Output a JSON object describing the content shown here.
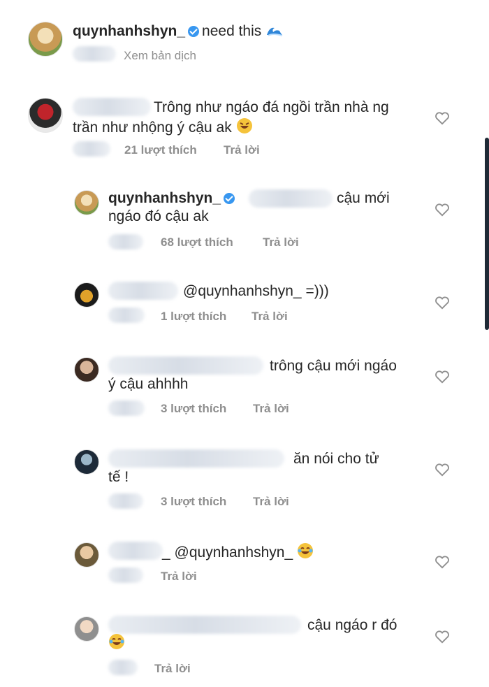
{
  "post": {
    "username": "quynhanhshyn_",
    "caption": "need this",
    "caption_emoji": "wave-icon",
    "translate_label": "Xem bản dịch"
  },
  "comments": [
    {
      "text_line1": "Trông như ngáo đá ngồi trần nhà ng",
      "text_line2": "trần như nhộng ý cậu ak",
      "emoji": "rofl-emoji",
      "likes": "21 lượt thích",
      "reply_label": "Trả lời"
    },
    {
      "username": "quynhanhshyn_",
      "text_line1": "cậu mới",
      "text_line2": "ngáo đó cậu ak",
      "likes": "68 lượt thích",
      "reply_label": "Trả lời"
    },
    {
      "text_line1": "@quynhanhshyn_ =)))",
      "likes": "1 lượt thích",
      "reply_label": "Trả lời"
    },
    {
      "text_line1": "trông cậu mới ngáo",
      "text_line2": "ý cậu ahhhh",
      "likes": "3 lượt thích",
      "reply_label": "Trả lời"
    },
    {
      "text_line1": "ăn nói cho tử",
      "text_line2": "tế !",
      "likes": "3 lượt thích",
      "reply_label": "Trả lời"
    },
    {
      "text_line1": "_ @quynhanhshyn_",
      "emoji": "tears-of-joy-emoji",
      "reply_label": "Trả lời"
    },
    {
      "text_line1": "cậu ngáo r đó",
      "emoji": "tears-of-joy-emoji",
      "reply_label": "Trả lời"
    }
  ],
  "colors": {
    "text": "#262626",
    "meta": "#8e8e8e",
    "verified": "#3897f0"
  }
}
